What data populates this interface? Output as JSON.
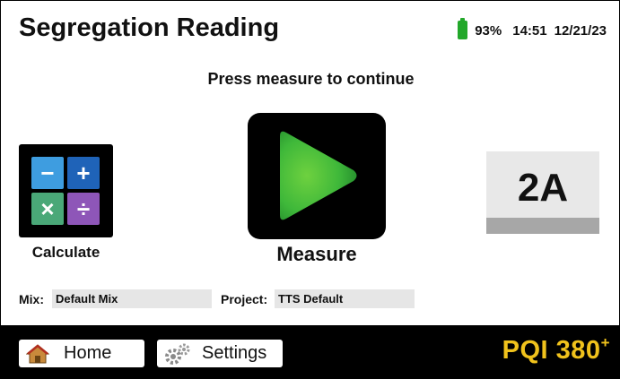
{
  "header": {
    "title": "Segregation Reading",
    "battery_percent": "93%",
    "time": "14:51",
    "date": "12/21/23"
  },
  "prompt": "Press measure to continue",
  "calculate": {
    "label": "Calculate",
    "keys": [
      {
        "symbol": "−",
        "color": "#3e9de0"
      },
      {
        "symbol": "+",
        "color": "#1f63b8"
      },
      {
        "symbol": "×",
        "color": "#4aa878"
      },
      {
        "symbol": "÷",
        "color": "#8e56b8"
      }
    ]
  },
  "measure": {
    "label": "Measure",
    "icon": "play-icon"
  },
  "lane": {
    "label": "2A"
  },
  "mix": {
    "label": "Mix:",
    "value": "Default Mix"
  },
  "project": {
    "label": "Project:",
    "value": "TTS Default"
  },
  "nav": {
    "home": {
      "label": "Home",
      "icon": "home-icon"
    },
    "settings": {
      "label": "Settings",
      "icon": "gears-icon"
    }
  },
  "brand": {
    "name": "PQI 380",
    "superscript": "+",
    "color": "#f0c21c"
  },
  "colors": {
    "battery": "#22a82a",
    "play_green": "#3fb83a"
  }
}
